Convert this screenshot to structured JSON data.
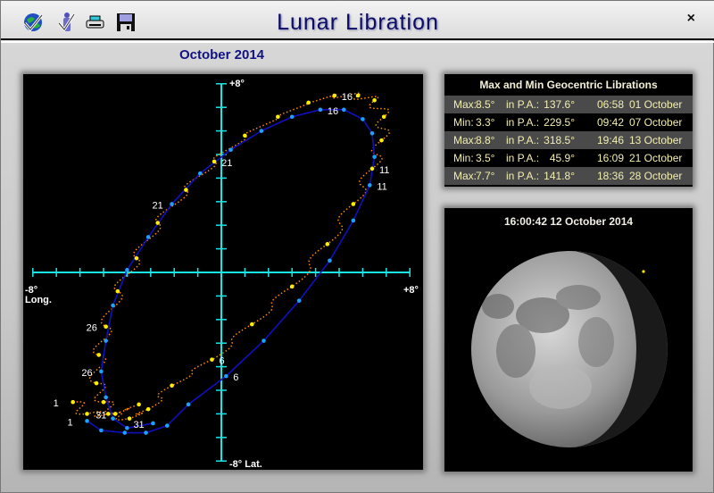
{
  "window": {
    "title": "Lunar Libration",
    "close_label": "×"
  },
  "toolbar": [
    {
      "icon": "globe-check-icon"
    },
    {
      "icon": "person-check-icon"
    },
    {
      "icon": "printer-icon"
    },
    {
      "icon": "save-disk-icon"
    }
  ],
  "month_label": "October 2014",
  "table": {
    "title": "Max and Min Geocentric Librations",
    "rows": [
      {
        "type": "Max:",
        "value": "8.5°",
        "pa_label": "in P.A.:",
        "pa": "137.6°",
        "time": "06:58",
        "date": "01 October"
      },
      {
        "type": "Min:",
        "value": "3.3°",
        "pa_label": "in P.A.:",
        "pa": "229.5°",
        "time": "09:42",
        "date": "07 October"
      },
      {
        "type": "Max:",
        "value": "8.8°",
        "pa_label": "in P.A.:",
        "pa": "318.5°",
        "time": "19:46",
        "date": "13 October"
      },
      {
        "type": "Min:",
        "value": "3.5°",
        "pa_label": "in P.A.:",
        "pa": "45.9°",
        "time": "16:09",
        "date": "21 October"
      },
      {
        "type": "Max:",
        "value": "7.7°",
        "pa_label": "in P.A.:",
        "pa": "141.8°",
        "time": "18:36",
        "date": "28 October"
      }
    ]
  },
  "moon": {
    "timestamp": "16:00:42  12 October 2014",
    "phase": "waning gibbous"
  },
  "chart_data": {
    "type": "scatter",
    "xlim": [
      -8,
      8
    ],
    "ylim": [
      -8,
      8
    ],
    "x_min_label": "-8°",
    "x_max_label": "+8°",
    "xlabel": "Long.",
    "y_max_label": "+8°",
    "y_min_label": "-8° Lat.",
    "colors": {
      "axis": "#19e6e6",
      "geocentric": "#1010c0",
      "geocentric_dots": "#1ea0ff",
      "topocentric": "#ff8c00",
      "topocentric_dots": "#ffee00",
      "labels": "#ffffff"
    },
    "series": [
      {
        "points": [
          [
            -5.7,
            -6.3
          ],
          [
            -5.1,
            -6.7
          ],
          [
            -4.1,
            -6.8
          ],
          [
            -3.2,
            -6.8
          ],
          [
            -2.3,
            -6.5
          ],
          [
            -1.4,
            -5.6
          ],
          [
            0.2,
            -4.4
          ],
          [
            1.8,
            -2.9
          ],
          [
            3.3,
            -1.2
          ],
          [
            4.6,
            0.5
          ],
          [
            5.6,
            2.2
          ],
          [
            6.3,
            3.7
          ],
          [
            6.5,
            4.9
          ],
          [
            6.4,
            5.9
          ],
          [
            6.0,
            6.5
          ],
          [
            5.2,
            6.9
          ],
          [
            4.2,
            6.9
          ],
          [
            3.0,
            6.6
          ],
          [
            1.7,
            6.0
          ],
          [
            0.4,
            5.2
          ],
          [
            -0.9,
            4.2
          ],
          [
            -2.1,
            2.9
          ],
          [
            -3.1,
            1.5
          ],
          [
            -4.0,
            0.1
          ],
          [
            -4.6,
            -1.4
          ],
          [
            -4.9,
            -2.9
          ],
          [
            -5.1,
            -4.2
          ],
          [
            -4.9,
            -5.3
          ],
          [
            -4.6,
            -6.2
          ],
          [
            -4.0,
            -6.6
          ],
          [
            -2.9,
            -6.4
          ]
        ],
        "day_labels": [
          {
            "day": "1",
            "index": 0
          },
          {
            "day": "6",
            "index": 6
          },
          {
            "day": "11",
            "index": 11
          },
          {
            "day": "16",
            "index": 16
          },
          {
            "day": "21",
            "index": 21
          },
          {
            "day": "26",
            "index": 26
          },
          {
            "day": "31",
            "index": 30
          }
        ]
      },
      {
        "points": [
          [
            -6.3,
            -5.5
          ],
          [
            -5.7,
            -6.0
          ],
          [
            -4.8,
            -6.0
          ],
          [
            -3.9,
            -6.2
          ],
          [
            -3.1,
            -5.8
          ],
          [
            -2.1,
            -4.8
          ],
          [
            -0.4,
            -3.7
          ],
          [
            1.3,
            -2.2
          ],
          [
            3.0,
            -0.6
          ],
          [
            4.5,
            1.2
          ],
          [
            5.6,
            2.9
          ],
          [
            6.4,
            4.4
          ],
          [
            6.8,
            5.6
          ],
          [
            6.9,
            6.6
          ],
          [
            6.5,
            7.3
          ],
          [
            5.8,
            7.5
          ],
          [
            4.8,
            7.5
          ],
          [
            3.7,
            7.2
          ],
          [
            2.4,
            6.6
          ],
          [
            1.0,
            5.8
          ],
          [
            -0.3,
            4.7
          ],
          [
            -1.5,
            3.5
          ],
          [
            -2.7,
            2.1
          ],
          [
            -3.6,
            0.6
          ],
          [
            -4.4,
            -0.8
          ],
          [
            -4.9,
            -2.3
          ],
          [
            -5.2,
            -3.5
          ],
          [
            -5.3,
            -4.7
          ],
          [
            -5.0,
            -5.5
          ],
          [
            -4.5,
            -6.0
          ],
          [
            -3.5,
            -5.6
          ]
        ],
        "day_labels": [
          {
            "day": "1",
            "index": 0
          },
          {
            "day": "6",
            "index": 6
          },
          {
            "day": "11",
            "index": 11
          },
          {
            "day": "16",
            "index": 16
          },
          {
            "day": "21",
            "index": 20
          },
          {
            "day": "26",
            "index": 25
          },
          {
            "day": "31",
            "index": 29
          }
        ]
      }
    ]
  }
}
